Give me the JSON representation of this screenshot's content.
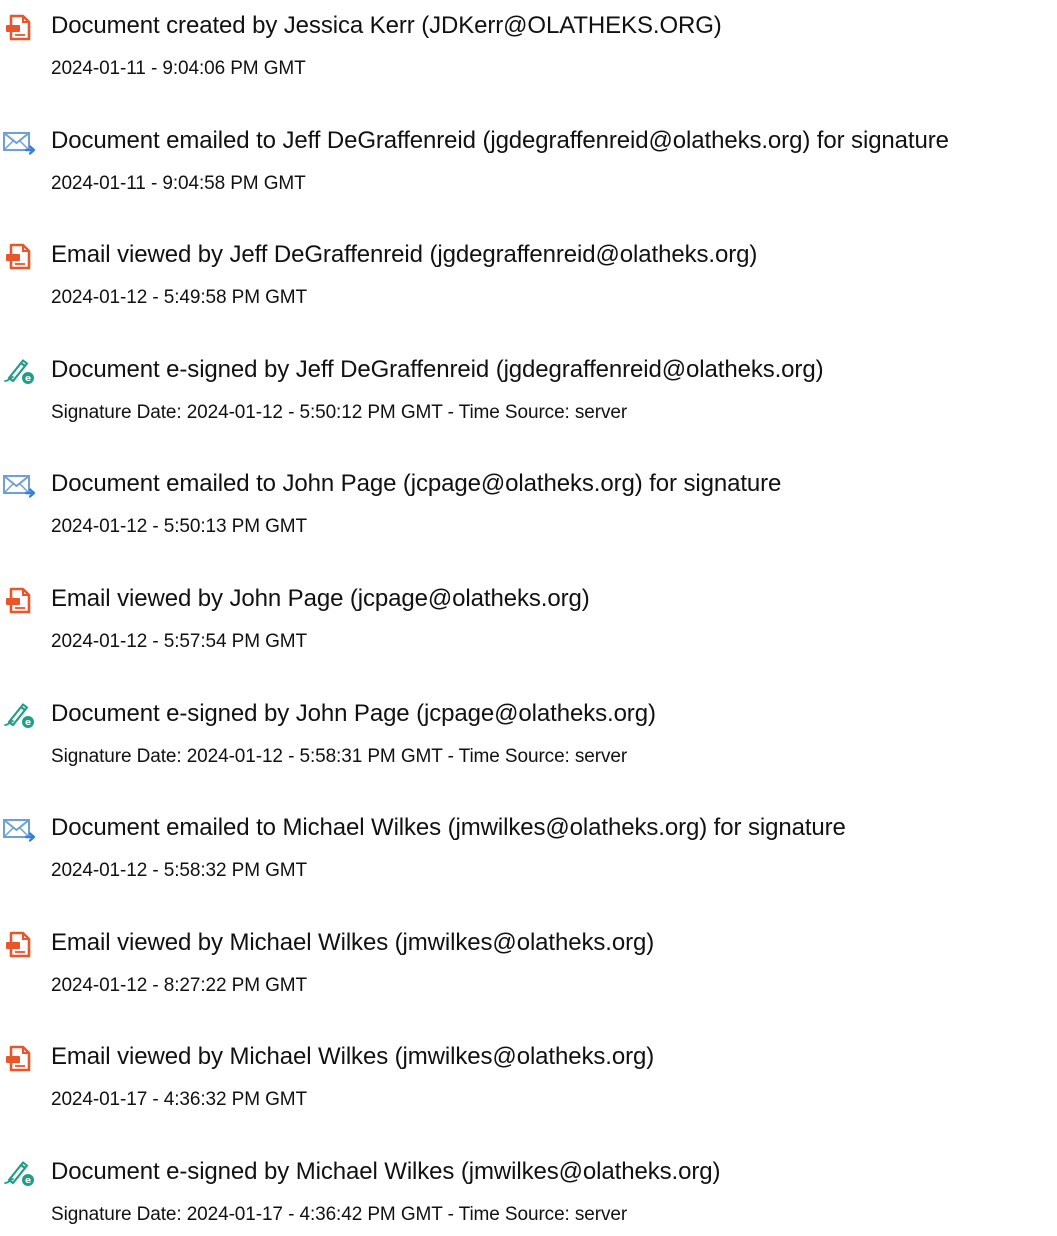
{
  "colors": {
    "created_icon": "#e8562b",
    "emailed_icon": "#3b7fd4",
    "signed_icon": "#1f9e86"
  },
  "events": [
    {
      "type": "created",
      "icon": "document-created-icon",
      "title": "Document created by Jessica Kerr (JDKerr@OLATHEKS.ORG)",
      "detail": "2024-01-11 - 9:04:06 PM GMT"
    },
    {
      "type": "emailed",
      "icon": "email-sent-icon",
      "title": "Document emailed to Jeff DeGraffenreid (jgdegraffenreid@olatheks.org) for signature",
      "detail": "2024-01-11 - 9:04:58 PM GMT"
    },
    {
      "type": "viewed",
      "icon": "document-viewed-icon",
      "title": "Email viewed by Jeff DeGraffenreid (jgdegraffenreid@olatheks.org)",
      "detail": "2024-01-12 - 5:49:58 PM GMT"
    },
    {
      "type": "signed",
      "icon": "e-sign-pen-icon",
      "title": "Document e-signed by Jeff DeGraffenreid (jgdegraffenreid@olatheks.org)",
      "detail": "Signature Date: 2024-01-12 - 5:50:12 PM GMT - Time Source: server"
    },
    {
      "type": "emailed",
      "icon": "email-sent-icon",
      "title": "Document emailed to John Page (jcpage@olatheks.org) for signature",
      "detail": "2024-01-12 - 5:50:13 PM GMT"
    },
    {
      "type": "viewed",
      "icon": "document-viewed-icon",
      "title": "Email viewed by John Page (jcpage@olatheks.org)",
      "detail": "2024-01-12 - 5:57:54 PM GMT"
    },
    {
      "type": "signed",
      "icon": "e-sign-pen-icon",
      "title": "Document e-signed by John Page (jcpage@olatheks.org)",
      "detail": "Signature Date: 2024-01-12 - 5:58:31 PM GMT - Time Source: server"
    },
    {
      "type": "emailed",
      "icon": "email-sent-icon",
      "title": "Document emailed to Michael Wilkes (jmwilkes@olatheks.org) for signature",
      "detail": "2024-01-12 - 5:58:32 PM GMT"
    },
    {
      "type": "viewed",
      "icon": "document-viewed-icon",
      "title": "Email viewed by Michael Wilkes (jmwilkes@olatheks.org)",
      "detail": "2024-01-12 - 8:27:22 PM GMT"
    },
    {
      "type": "viewed",
      "icon": "document-viewed-icon",
      "title": "Email viewed by Michael Wilkes (jmwilkes@olatheks.org)",
      "detail": "2024-01-17 - 4:36:32 PM GMT"
    },
    {
      "type": "signed",
      "icon": "e-sign-pen-icon",
      "title": "Document e-signed by Michael Wilkes (jmwilkes@olatheks.org)",
      "detail": "Signature Date: 2024-01-17 - 4:36:42 PM GMT - Time Source: server"
    }
  ]
}
